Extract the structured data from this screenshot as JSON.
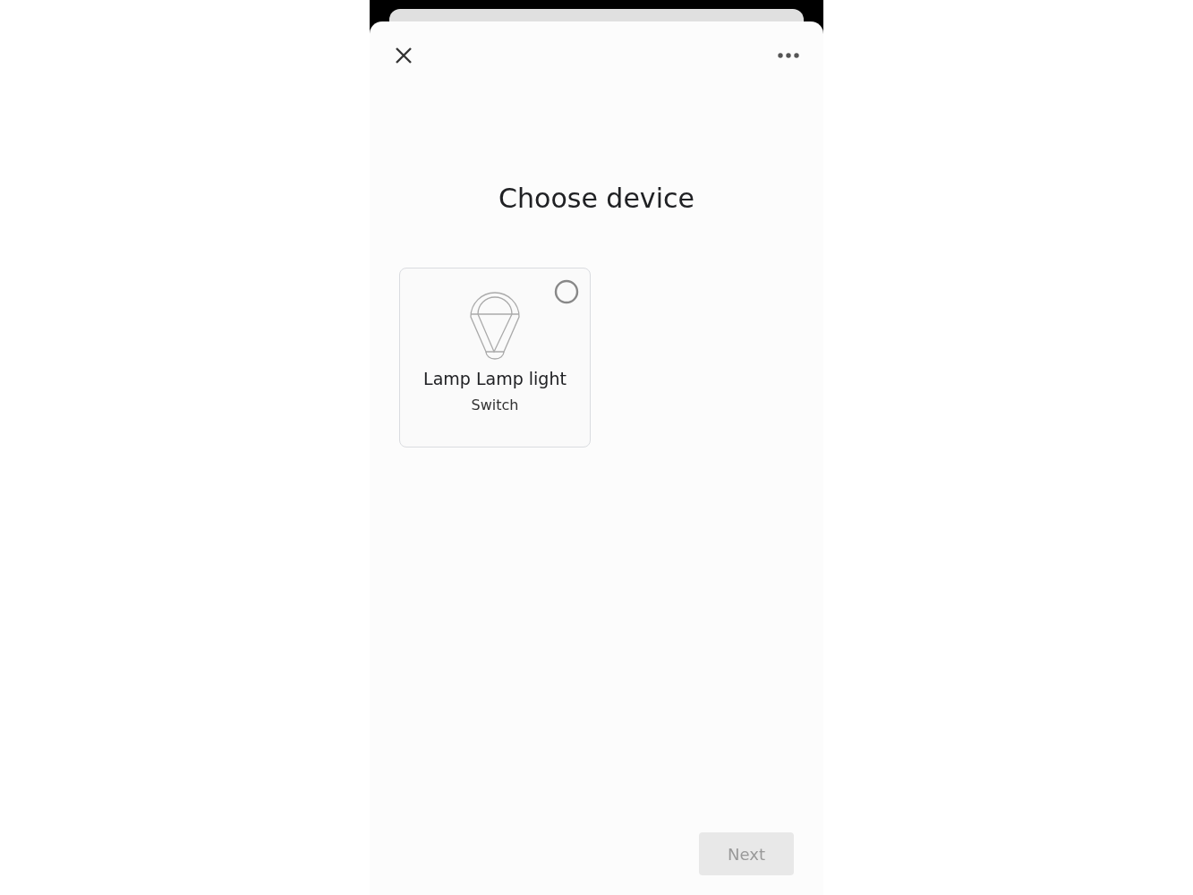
{
  "title": "Choose device",
  "devices": [
    {
      "name": "Lamp Lamp light",
      "type": "Switch",
      "selected": false
    }
  ],
  "next_button": {
    "label": "Next",
    "disabled": true
  }
}
